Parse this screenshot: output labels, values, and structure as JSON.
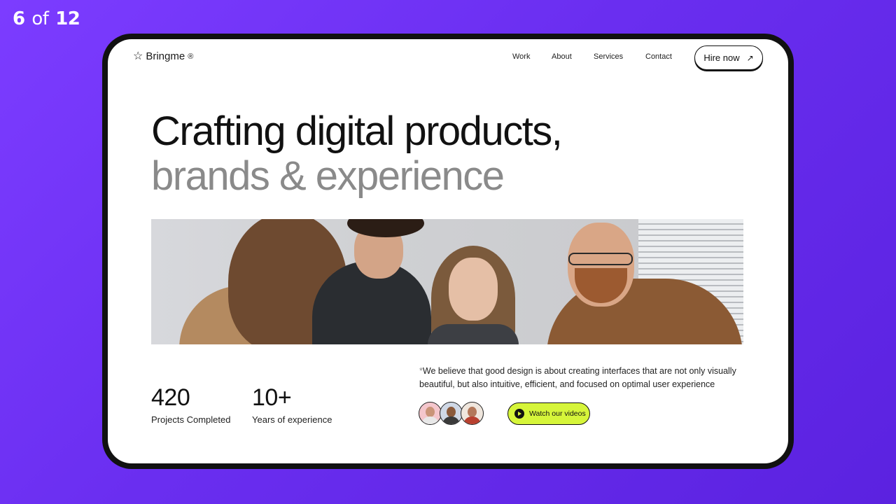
{
  "slide_counter": {
    "current": "6",
    "separator": "of",
    "total": "12"
  },
  "nav": {
    "brand": "Bringme",
    "brand_mark": "®",
    "items": [
      "Work",
      "About",
      "Services",
      "Contact"
    ],
    "cta_label": "Hire now",
    "cta_icon": "arrow-up-right-icon"
  },
  "hero": {
    "line1": "Crafting digital products,",
    "line2": "brands & experience"
  },
  "stats": [
    {
      "value": "420",
      "label": "Projects Completed"
    },
    {
      "value": "10+",
      "label": "Years of experience"
    }
  ],
  "quote": {
    "asterisk": "*",
    "text": "We believe that good design is about creating interfaces that are not only visually beautiful, but also intuitive, efficient, and focused on optimal user experience"
  },
  "video_button": {
    "label": "Watch our videos",
    "icon": "play-icon"
  },
  "colors": {
    "background": "#6a2ef0",
    "accent": "#d6f53a",
    "headline_primary": "#111111",
    "headline_secondary": "#8a8a8a"
  }
}
